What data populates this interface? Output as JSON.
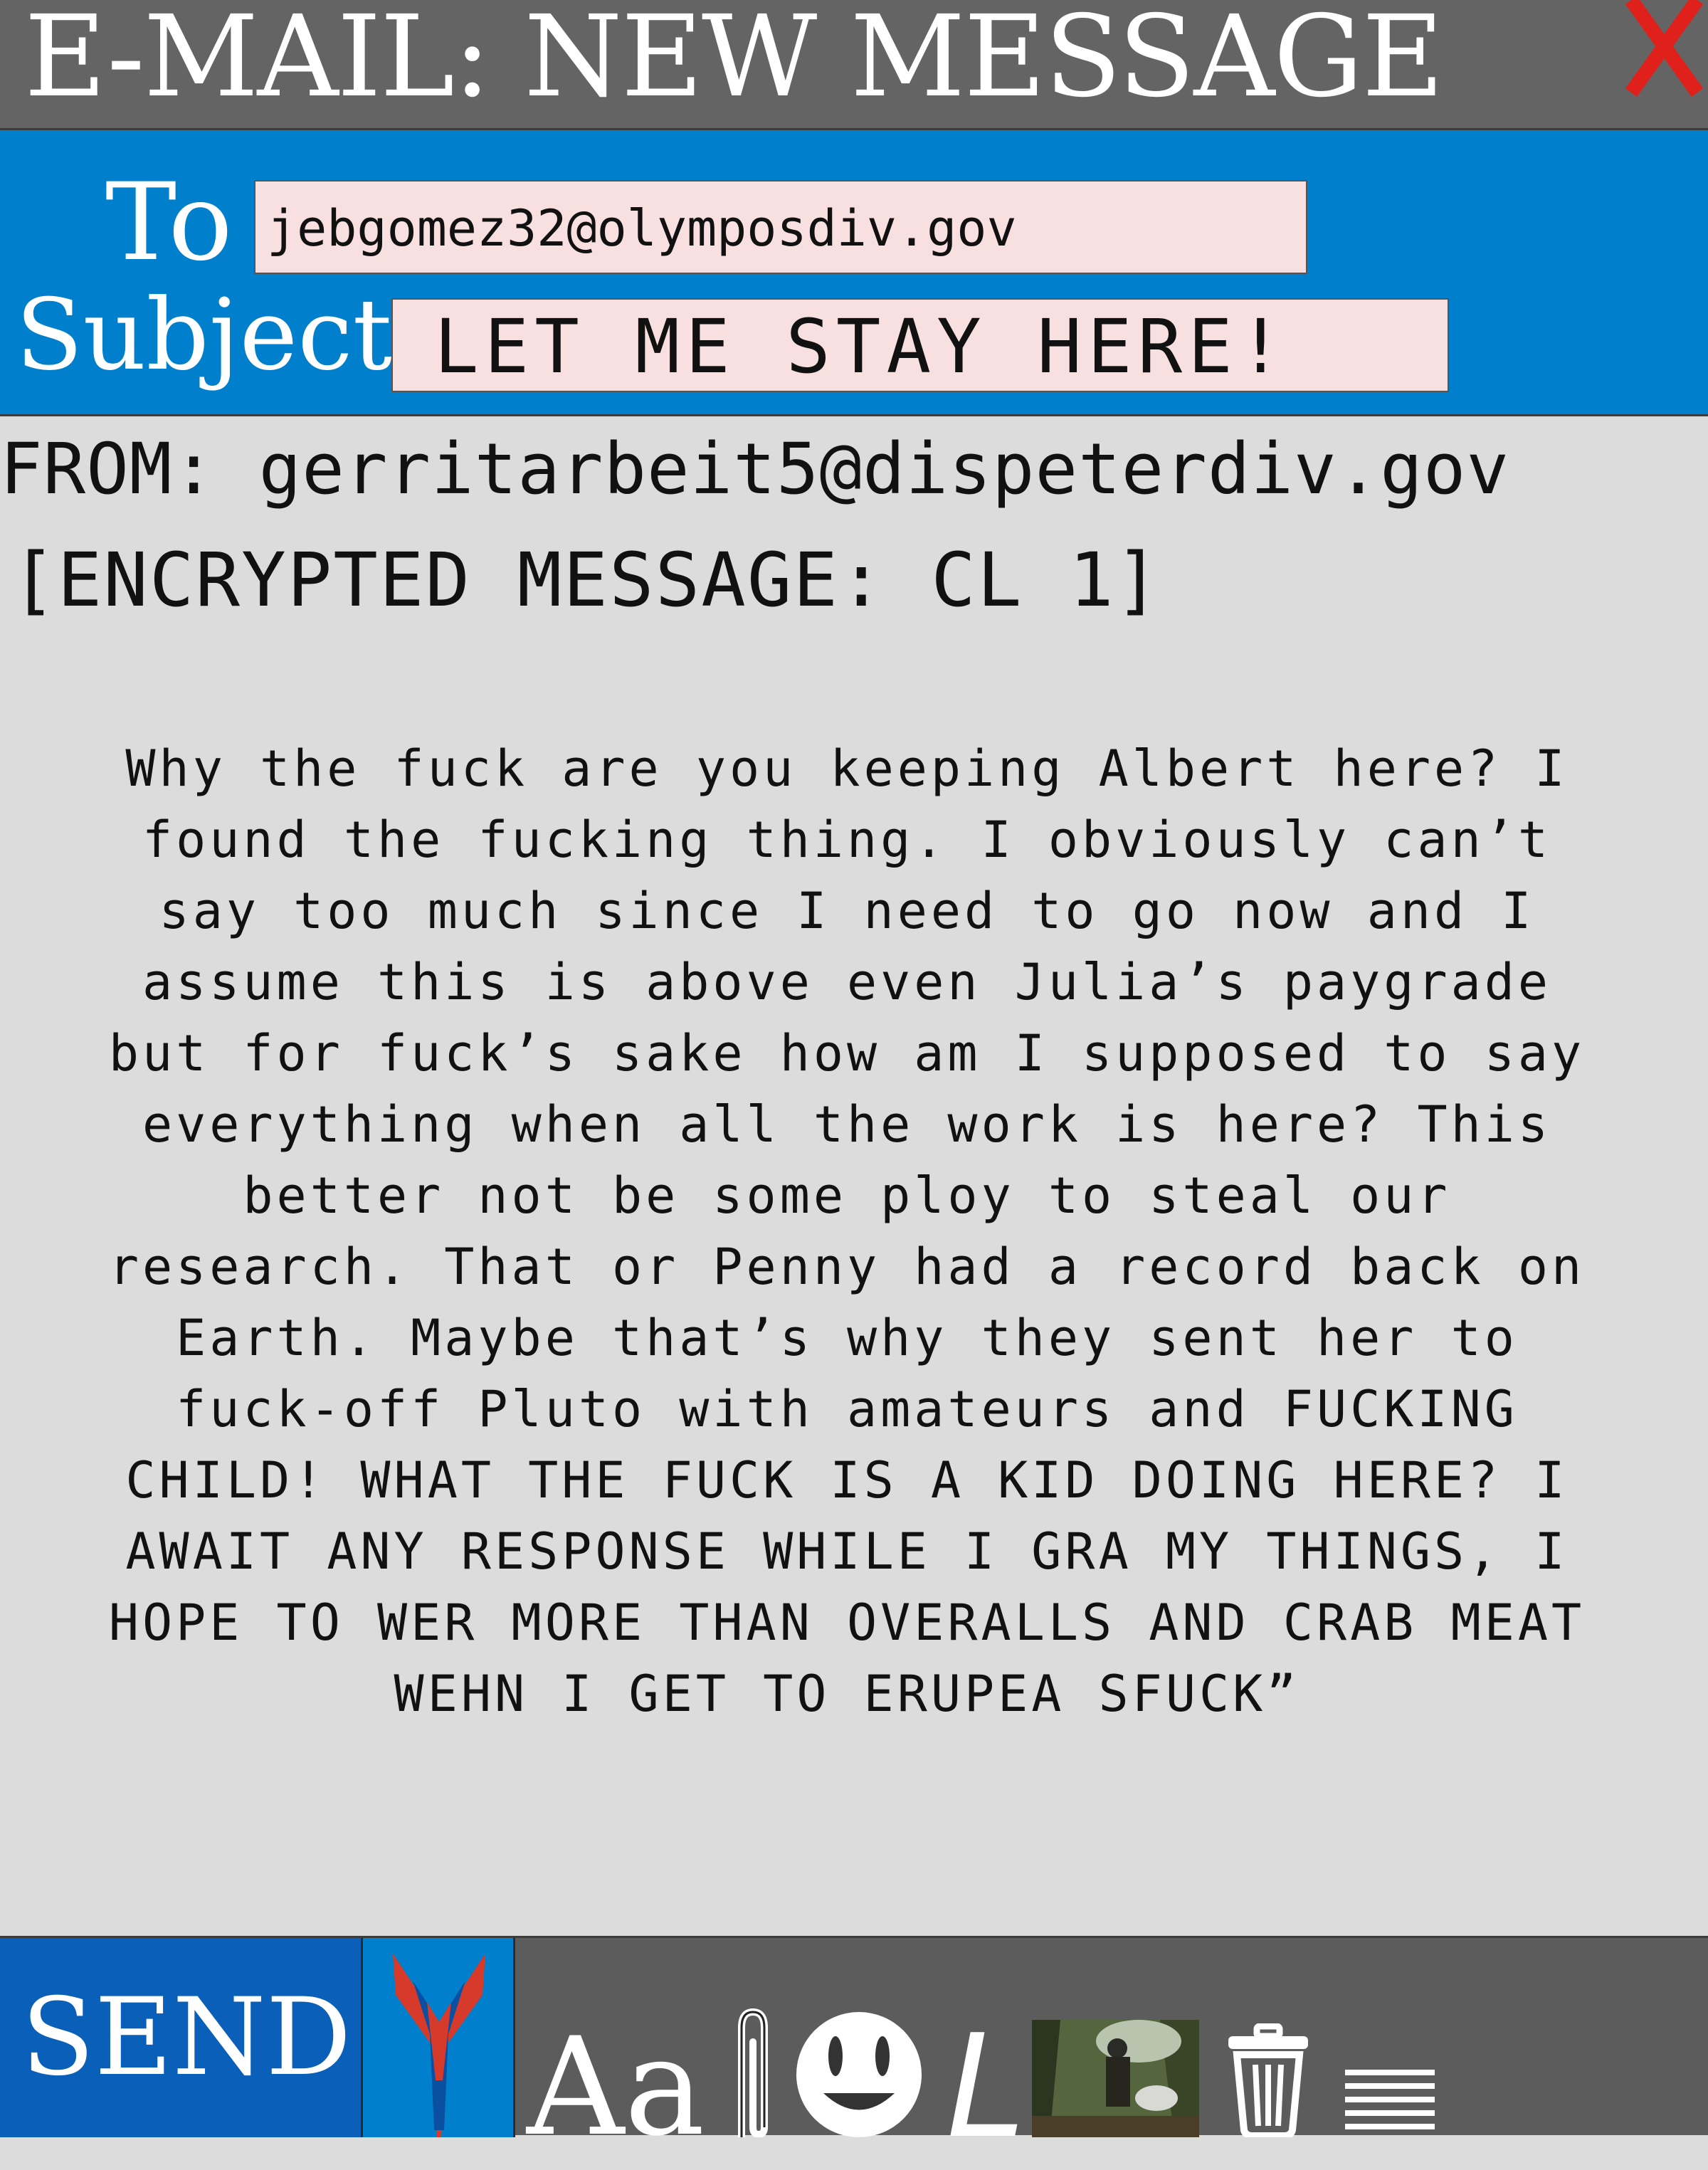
{
  "window": {
    "title": "E-MAIL: NEW MESSAGE",
    "close_label": "X",
    "close_color": "#e0201a"
  },
  "header": {
    "to_label": "To",
    "to_value": "jebgomez32@olymposdiv.gov",
    "subject_label": "Subject",
    "subject_value": "LET ME STAY HERE!"
  },
  "message": {
    "from": "FROM: gerritarbeit5@dispeterdiv.gov",
    "encryption": "[ENCRYPTED MESSAGE: CL 1]",
    "body_lines": [
      "Why the fuck are you keeping Albert here? I",
      "found the fucking thing. I obviously can’t",
      "say too much since I need to go now and I",
      "assume this is above even Julia’s paygrade",
      "but for fuck’s sake how am I supposed to say",
      "everything when all the work is here? This",
      "better not be some ploy to steal our",
      "research. That or Penny had a record back on",
      "Earth. Maybe that’s why they sent her to",
      "fuck-off Pluto with amateurs and FUCKING",
      "CHILD! WHAT THE FUCK IS A KID DOING HERE? I",
      "AWAIT ANY RESPONSE WHILE I GRA MY THINGS, I",
      "HOPE TO WER MORE THAN OVERALLS AND CRAB MEAT",
      "WEHN I GET TO ERUPEA SFUCK”"
    ]
  },
  "toolbar": {
    "send_label": "SEND",
    "font_label": "Aa",
    "italic_label": "L",
    "icons": [
      "logo-icon",
      "font-icon",
      "paperclip-icon",
      "smiley-icon",
      "italic-icon",
      "image-thumbnail",
      "trash-icon",
      "align-icon"
    ]
  },
  "colors": {
    "titlebar": "#646464",
    "header": "#0080cc",
    "field_bg": "#f8dfe0",
    "send_button": "#0a5fb8",
    "footer": "#5c5c5c",
    "background": "#dcdcdc"
  }
}
